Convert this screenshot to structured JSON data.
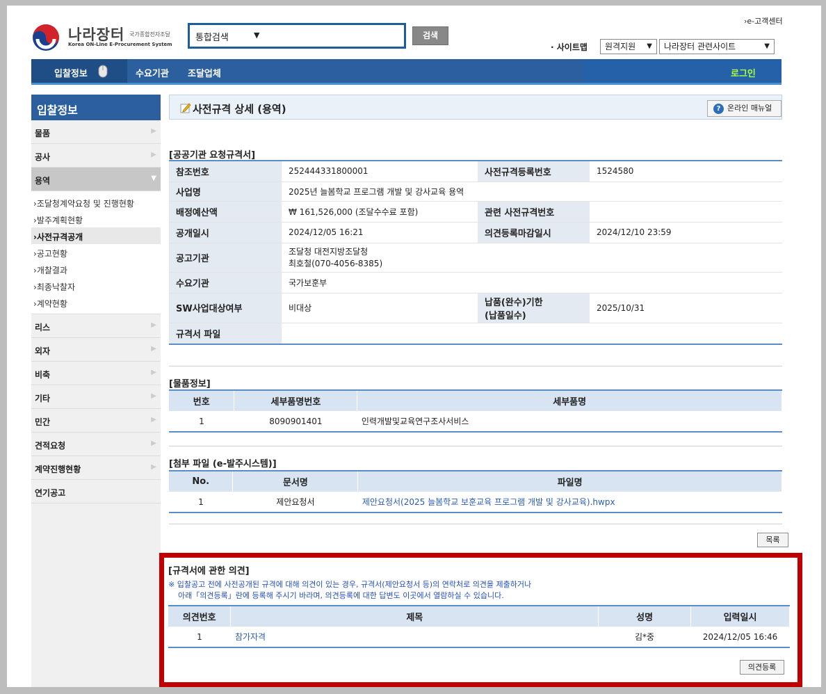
{
  "header": {
    "logo_name": "나라장터",
    "logo_sub_kr": "국가종합전자조달",
    "logo_sub_en": "Korea ON-Line E-Procurement System",
    "search_scope": "통합검색",
    "search_button": "검색",
    "support_link": "›e-고객센터",
    "sitemap_link": "· 사이트맵",
    "remote_select": "원격지원",
    "related_select": "나라장터 관련사이트"
  },
  "nav": {
    "bid": "입찰정보",
    "demand": "수요기관",
    "supplier": "조달업체",
    "login": "로그인"
  },
  "sidebar": {
    "title": "입찰정보",
    "items_top": [
      "물품",
      "공사",
      "용역"
    ],
    "sub_items": [
      "조달청계약요청 및 진행현황",
      "발주계획현황",
      "사전규격공개",
      "공고현황",
      "개찰결과",
      "최종낙찰자",
      "계약현황"
    ],
    "active_sub": "사전규격공개",
    "items_bottom": [
      "리스",
      "외자",
      "비축",
      "기타",
      "민간",
      "견적요청",
      "계약진행현황",
      "연기공고"
    ]
  },
  "page": {
    "title": "사전규격 상세 (용역)",
    "manual_button": "온라인 매뉴얼"
  },
  "spec": {
    "section_title": "[공공기관 요청규격서]",
    "ref_no_label": "참조번호",
    "ref_no": "252444331800001",
    "reg_no_label": "사전규격등록번호",
    "reg_no": "1524580",
    "project_label": "사업명",
    "project": "2025년 늘봄학교 프로그램 개발 및 강사교육 용역",
    "budget_label": "배정예산액",
    "budget": "₩  161,526,000 (조달수수료 포함)",
    "related_label": "관련 사전규격번호",
    "related": "",
    "open_date_label": "공개일시",
    "open_date": "2024/12/05 16:21",
    "deadline_label": "의견등록마감일시",
    "deadline": "2024/12/10 23:59",
    "agency_label": "공고기관",
    "agency_line1": "조달청 대전지방조달청",
    "agency_line2": "최호철(070-4056-8385)",
    "demand_label": "수요기관",
    "demand": "국가보훈부",
    "sw_label": "SW사업대상여부",
    "sw": "비대상",
    "delivery_label_1": "납품(완수)기한",
    "delivery_label_2": "(납품일수)",
    "delivery": "2025/10/31",
    "file_label": "규격서 파일",
    "file": ""
  },
  "goods": {
    "section_title": "[물품정보]",
    "columns": [
      "번호",
      "세부품명번호",
      "세부품명"
    ],
    "rows": [
      [
        "1",
        "8090901401",
        "인력개발및교육연구조사서비스"
      ]
    ]
  },
  "attachments": {
    "section_title": "[첨부 파일 (e-발주시스템)]",
    "columns": [
      "No.",
      "문서명",
      "파일명"
    ],
    "rows": [
      [
        "1",
        "제안요청서",
        "제안요청서(2025 늘봄학교 보훈교육 프로그램 개발 및 강사교육).hwpx"
      ]
    ]
  },
  "list_button": "목록",
  "opinions": {
    "section_title": "[규격서에 관한 의견]",
    "note_line1": "※ 입찰공고 전에 사전공개된 규격에 대해 의견이 있는 경우, 규격서(제안요청서 등)의 연락처로 의견을 제출하거나",
    "note_line2": "아래「의견등록」란에 등록해 주시기 바라며, 의견등록에 대한 답변도 이곳에서 열람하실 수 있습니다.",
    "columns": [
      "의견번호",
      "제목",
      "성명",
      "입력일시"
    ],
    "rows": [
      [
        "1",
        "참가자격",
        "김*중",
        "2024/12/05 16:46"
      ]
    ],
    "register_button": "의견등록"
  },
  "colors": {
    "nav_blue": "#2c5f9d",
    "highlight_red": "#c00000",
    "login_green": "#aaff3c",
    "link_blue": "#2a5db0"
  }
}
